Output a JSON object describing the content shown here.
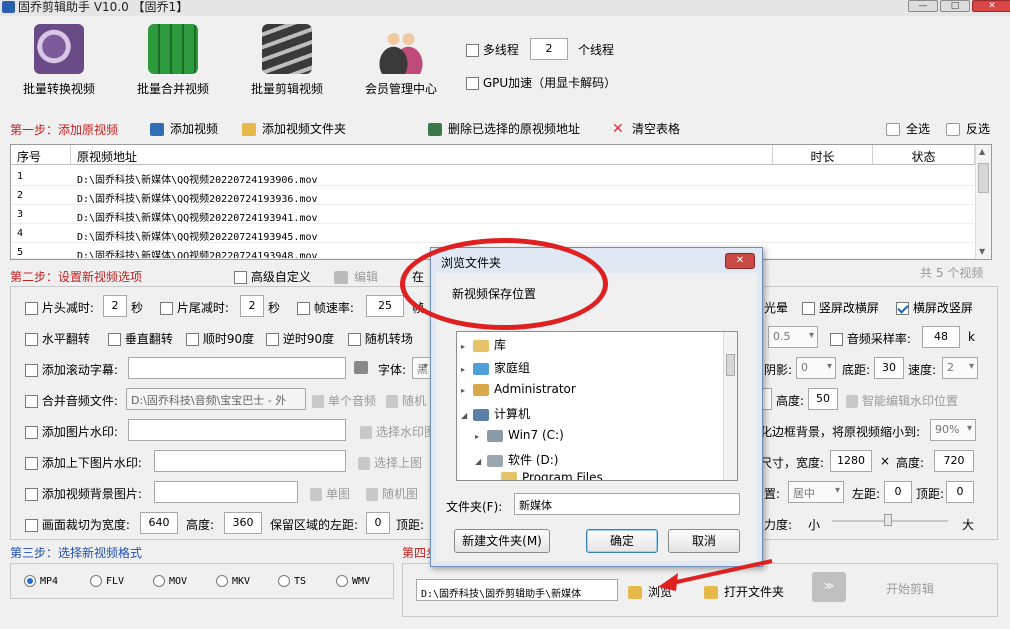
{
  "window": {
    "title": "固乔剪辑助手 V10.0 【固乔1】",
    "min": "—",
    "max": "□",
    "close": "✕"
  },
  "toolbar": {
    "tools": [
      {
        "label": "批量转换视频",
        "icon": "film-reel-icon"
      },
      {
        "label": "批量合并视频",
        "icon": "merge-film-icon"
      },
      {
        "label": "批量剪辑视频",
        "icon": "clapper-film-icon"
      },
      {
        "label": "会员管理中心",
        "icon": "users-icon"
      }
    ],
    "multithread": {
      "label": "多线程",
      "value": "2",
      "unit": "个线程"
    },
    "gpu": {
      "label": "GPU加速（用显卡解码）"
    }
  },
  "step1": {
    "label": "第一步：添加原视频",
    "add_video": "添加视频",
    "add_folder": "添加视频文件夹",
    "delete_selected": "删除已选择的原视频地址",
    "clear_table": "清空表格",
    "select_all": "全选",
    "invert": "反选"
  },
  "table": {
    "headers": [
      "序号",
      "原视频地址",
      "时长",
      "状态"
    ],
    "rows": [
      {
        "no": "1",
        "path": "D:\\固乔科技\\新媒体\\QQ视频20220724193906.mov"
      },
      {
        "no": "2",
        "path": "D:\\固乔科技\\新媒体\\QQ视频20220724193936.mov"
      },
      {
        "no": "3",
        "path": "D:\\固乔科技\\新媒体\\QQ视频20220724193941.mov"
      },
      {
        "no": "4",
        "path": "D:\\固乔科技\\新媒体\\QQ视频20220724193945.mov"
      },
      {
        "no": "5",
        "path": "D:\\固乔科技\\新媒体\\QQ视频20220724193948.mov"
      }
    ],
    "total": "共 5 个视频"
  },
  "step2": {
    "label": "第二步：设置新视频选项",
    "advanced": "高级自定义",
    "edit": "编辑",
    "at": "在",
    "head_cut": "片头减时:",
    "head_cut_val": "2",
    "sec": "秒",
    "tail_cut": "片尾减时:",
    "tail_cut_val": "2",
    "framerate": "帧速率:",
    "framerate_val": "25",
    "frame_tail": "帧",
    "light": "光晕",
    "h2v": "竖屏改横屏",
    "v2h": "横屏改竖屏",
    "flip_h": "水平翻转",
    "flip_v": "垂直翻转",
    "rot_cw": "顺时90度",
    "rot_ccw": "逆时90度",
    "rand_rot": "随机转场",
    "rate_sel": "0.5",
    "samplerate": "音频采样率:",
    "samplerate_val": "48",
    "k": "k",
    "scroll_sub": "添加滚动字幕:",
    "font": "字体:",
    "font_val": "黑",
    "shadow": "阴影:",
    "shadow_val": "0",
    "bottom": "底距:",
    "bottom_val": "30",
    "speed": "速度:",
    "speed_val": "2",
    "merge_audio": "合并音频文件:",
    "audio_path": "D:\\固乔科技\\音频\\宝宝巴士 - 外",
    "single_audio": "单个音频",
    "random": "随机",
    "height": "高度:",
    "height_val": "50",
    "smart_wm": "智能编辑水印位置",
    "img_wm": "添加图片水印:",
    "select_wm": "选择水印图",
    "border_bg": "化边框背景，将原视频缩小到:",
    "scale_val": "90%",
    "tb_img_wm": "添加上下图片水印:",
    "select_top": "选择上图",
    "size": "尺寸，宽度:",
    "width_val": "1280",
    "x": "×",
    "height2": "高度:",
    "height2_val": "720",
    "bg_img": "添加视频背景图片:",
    "single_img": "单图",
    "random_img": "随机图",
    "pos": "置:",
    "pos_val": "居中",
    "left": "左距:",
    "left_val": "0",
    "top": "顶距:",
    "top_val": "0",
    "crop": "画面裁切为宽度:",
    "crop_w": "640",
    "crop_h_label": "高度:",
    "crop_h": "360",
    "keep_left": "保留区域的左距:",
    "keep_left_val": "0",
    "top2": "顶距:",
    "strength": "力度:",
    "small": "小",
    "big": "大"
  },
  "step3": {
    "label": "第三步：选择新视频格式",
    "formats": [
      "MP4",
      "FLV",
      "MOV",
      "MKV",
      "TS",
      "WMV"
    ],
    "selected": "MP4"
  },
  "step4": {
    "label": "第四步",
    "path": "D:\\固乔科技\\固乔剪辑助手\\新媒体",
    "browse": "浏览",
    "open_folder": "打开文件夹",
    "start": "开始剪辑"
  },
  "dialog": {
    "title": "浏览文件夹",
    "prompt": "新视频保存位置",
    "tree": [
      {
        "label": "库",
        "icon": "library-icon",
        "level": 1,
        "toggle": "▸"
      },
      {
        "label": "家庭组",
        "icon": "homegroup-icon",
        "level": 1,
        "toggle": "▸"
      },
      {
        "label": "Administrator",
        "icon": "user-folder-icon",
        "level": 1,
        "toggle": "▸"
      },
      {
        "label": "计算机",
        "icon": "computer-icon",
        "level": 1,
        "toggle": "◢"
      },
      {
        "label": "Win7 (C:)",
        "icon": "drive-c-icon",
        "level": 2,
        "toggle": "▸"
      },
      {
        "label": "软件 (D:)",
        "icon": "drive-d-icon",
        "level": 2,
        "toggle": "◢"
      },
      {
        "label": "Program Files",
        "icon": "folder-icon",
        "level": 3,
        "toggle": ""
      }
    ],
    "folder_label": "文件夹(F):",
    "folder_value": "新媒体",
    "new_folder": "新建文件夹(M)",
    "ok": "确定",
    "cancel": "取消",
    "close": "✕"
  },
  "colors": {
    "step_red": "#c42020",
    "step_blue": "#1f4fb0",
    "annotation_red": "#e02020",
    "dialog_blue": "#dfe8f3"
  }
}
